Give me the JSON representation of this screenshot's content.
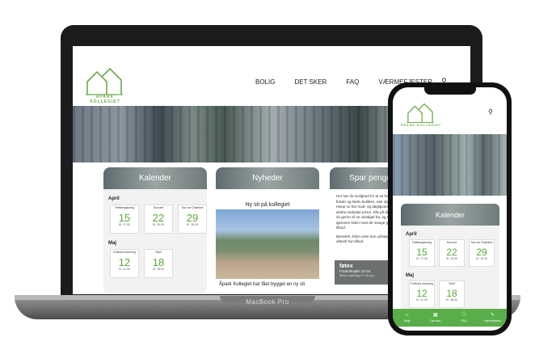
{
  "laptop": {
    "brand": "MacBook Pro"
  },
  "site": {
    "logo_text": "ÅPARK KOLLEGIET",
    "nav": [
      "BOLIG",
      "DET SKER",
      "FAQ",
      "VÆRMEFJESTER"
    ],
    "kalender": {
      "title": "Kalender",
      "months": [
        {
          "name": "April",
          "events": [
            {
              "name": "Fællesspisning",
              "day": "15",
              "time": "Kl. 17.00"
            },
            {
              "name": "Koncert",
              "day": "22",
              "time": "Kl. 20.00"
            },
            {
              "name": "Tour de Chambre",
              "day": "29",
              "time": "Kl. 15.30"
            }
          ]
        },
        {
          "name": "Maj",
          "events": [
            {
              "name": "Fodbold turnering",
              "day": "12",
              "time": "Kl. 11.00"
            },
            {
              "name": "\"Odd\"",
              "day": "18",
              "time": "Kl. 18.00"
            }
          ]
        }
      ]
    },
    "nyheder": {
      "title": "Nyheder",
      "headline": "Ny sti på kollegiet",
      "caption": "Åpark Kollegiet har fået bygget en ny sti"
    },
    "spar_penge": {
      "title": "Spar penge",
      "text": "Her har du mulighed for at se hvilke fiskær og Netto butikker, nær dig, der - netop nu har mad- og dagligvarer til ekstra nedsatte priser. Klik på den butik du gerne vil se udvalget fra, og scroll så igennem listen med de mange gode tilbud.",
      "note": "Bemærk: listen viser kun udsalg der er aktuelt har tilbud.",
      "store_brand": "føtex",
      "store_address": "Frederiksalle 22-24",
      "store_hours": "Åben mandag 07.00 og..."
    }
  },
  "phone": {
    "logo_text": "ÅPARK KOLLEGIET",
    "kalender": {
      "title": "Kalender",
      "months": [
        {
          "name": "April",
          "events": [
            {
              "name": "Fællesspisning",
              "day": "15",
              "time": "Kl. 17.00"
            },
            {
              "name": "Koncert",
              "day": "22",
              "time": "Kl. 20.00"
            },
            {
              "name": "Tour de Chambre",
              "day": "29",
              "time": "Kl. 15.30"
            }
          ]
        },
        {
          "name": "Maj",
          "events": [
            {
              "name": "Fodbold turnering",
              "day": "12",
              "time": "Kl. 11.00"
            },
            {
              "name": "\"Odd\"",
              "day": "18",
              "time": "Kl. 18.00"
            }
          ]
        }
      ]
    },
    "tabs": [
      {
        "label": "Bolig",
        "icon": "home-icon"
      },
      {
        "label": "Det sker",
        "icon": "calendar-icon"
      },
      {
        "label": "FAQ",
        "icon": "info-icon"
      },
      {
        "label": "Værmefjester",
        "icon": "tools-icon"
      }
    ]
  },
  "colors": {
    "accent": "#5aae4a",
    "day_green": "#5aa83a"
  }
}
